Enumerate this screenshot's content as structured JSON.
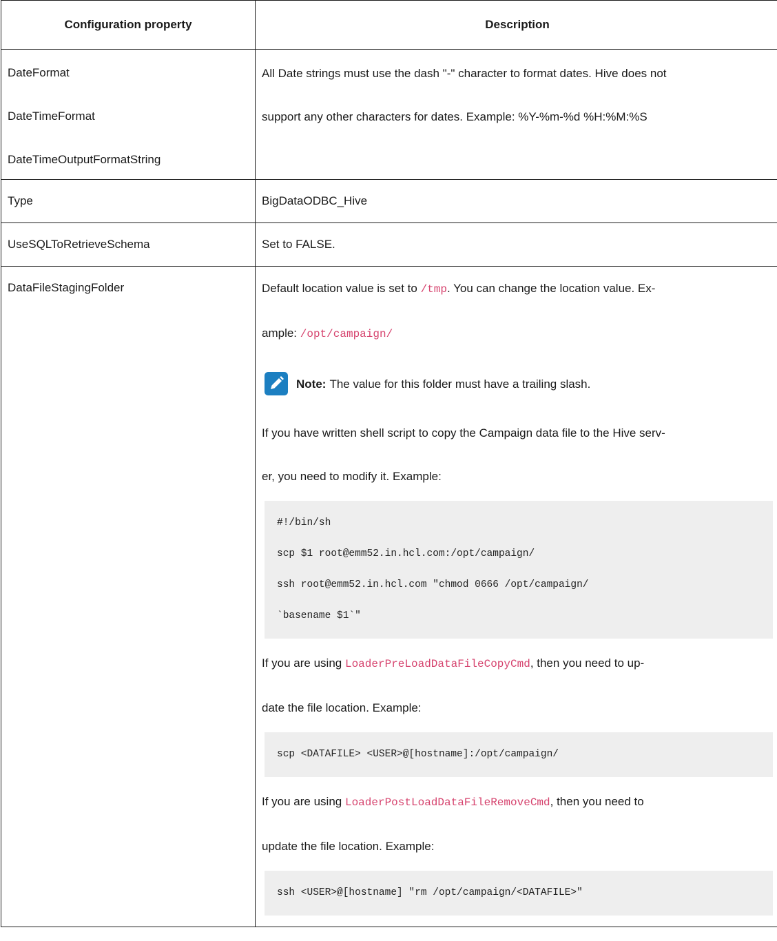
{
  "table": {
    "headers": [
      "Configuration property",
      "Description"
    ],
    "rows": [
      {
        "props": [
          "DateFormat",
          "DateTimeFormat",
          "DateTimeOutputFormatString"
        ],
        "desc_lines": [
          "All Date strings must use the dash \"-\" character to format dates. Hive does not",
          "support any other characters for dates. Example: %Y-%m-%d %H:%M:%S"
        ]
      },
      {
        "props": [
          "Type"
        ],
        "desc_lines": [
          "BigDataODBC_Hive"
        ]
      },
      {
        "props": [
          "UseSQLToRetrieveSchema"
        ],
        "desc_lines": [
          "Set to FALSE."
        ]
      },
      {
        "props": [
          "DataFileStagingFolder"
        ],
        "desc": {
          "p1_a": "Default location value is set to ",
          "p1_code": "/tmp",
          "p1_b": ". You can change the location value. Ex-",
          "p1_c": "ample: ",
          "p1_code2": "/opt/campaign/",
          "note_label": "Note:",
          "note_text": "The value for this folder must have a trailing slash.",
          "p2_line1": "If you have written shell script to copy the Campaign data file to the Hive serv-",
          "p2_line2": "er, you need to modify it. Example:",
          "code1": [
            "#!/bin/sh",
            "scp $1 root@emm52.in.hcl.com:/opt/campaign/",
            "ssh root@emm52.in.hcl.com \"chmod 0666 /opt/campaign/",
            "`basename $1`\""
          ],
          "p3_a": "If you are using ",
          "p3_code": "LoaderPreLoadDataFileCopyCmd",
          "p3_b": ", then you need to up-",
          "p3_line2": "date the file location. Example:",
          "code2": [
            "scp <DATAFILE> <USER>@[hostname]:/opt/campaign/"
          ],
          "p4_a": "If you are using ",
          "p4_code": "LoaderPostLoadDataFileRemoveCmd",
          "p4_b": ", then you need to",
          "p4_line2": "update the file location. Example:",
          "code3": [
            "ssh <USER>@[hostname] \"rm /opt/campaign/<DATAFILE>\""
          ]
        }
      }
    ]
  },
  "colors": {
    "code_inline": "#d6436e",
    "note_icon_bg": "#1c7fc1",
    "code_block_bg": "#eeeeee"
  },
  "icons": {
    "note": "pencil-clipboard-icon"
  }
}
